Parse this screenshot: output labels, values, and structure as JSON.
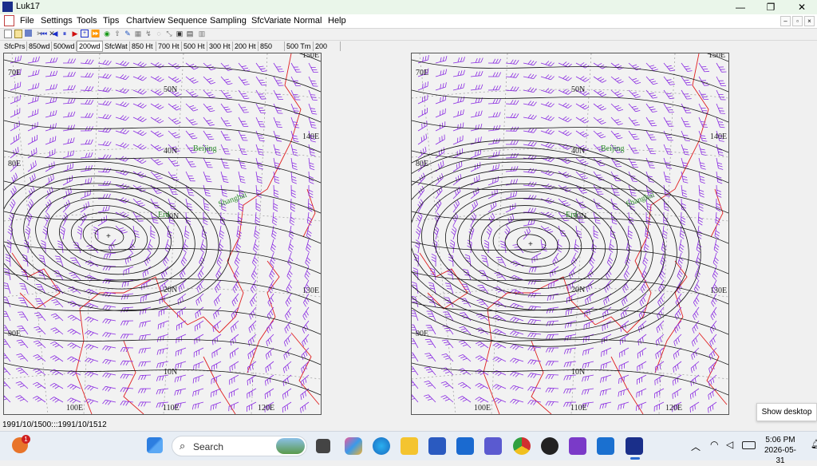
{
  "window": {
    "title": "Luk17",
    "minimize": "—",
    "maximize": "❐",
    "close": "✕"
  },
  "menu": [
    "File",
    "Settings",
    "Tools",
    "Tips",
    "Chartview",
    "Sequence",
    "Sampling",
    "SfcVariate",
    "Normal",
    "Help"
  ],
  "mdi_buttons": [
    "–",
    "▫",
    "×"
  ],
  "toolbar_icons": [
    "new-icon",
    "open-icon",
    "save-icon",
    "cut-icon",
    "cross-icon",
    "first-icon",
    "prev-icon",
    "play-icon",
    "next-icon",
    "last-icon",
    "frame-icon",
    "fast-forward-icon",
    "globe-icon",
    "upload-icon",
    "pen-icon",
    "grid-icon",
    "curve-icon",
    "zoom-icon",
    "window-icon",
    "table-icon",
    "layer-icon"
  ],
  "tabs": [
    "SfcPrs",
    "850wd",
    "500wd",
    "200wd",
    "SfcWat",
    "850 Ht",
    "700 Ht",
    "500 Ht",
    "300 Ht",
    "200 Ht",
    "850 Tm",
    "500 Tm",
    "200 Tm"
  ],
  "active_tab": "200wd",
  "map_labels": {
    "lat_50": "50N",
    "lat_40": "40N",
    "lat_30": "30N",
    "lat_20": "20N",
    "lat_10": "10N",
    "lon_70": "70E",
    "lon_80": "80E",
    "lon_90": "90E",
    "lon_100": "100E",
    "lon_110": "110E",
    "lon_120": "120E",
    "lon_130": "130E",
    "lon_140": "140E",
    "lon_150": "150E",
    "city_beijing": "Beijing",
    "city_shanghai": "Shanghai",
    "city_chengdu": "Erd"
  },
  "status_text": "1991/10/1500:::1991/10/1512",
  "tooltip": "Show desktop",
  "search": {
    "placeholder": "Search"
  },
  "notification_badge": "1",
  "clock": {
    "time": "5:06 PM",
    "date": "2026-05-31"
  },
  "colors": {
    "isobar": "#111111",
    "wind_barb": "#8a2be2",
    "coastline": "#e02020",
    "grid": "#9a9a9a"
  }
}
